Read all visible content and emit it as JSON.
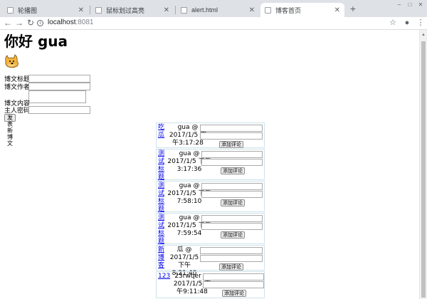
{
  "browser": {
    "tabs": [
      {
        "label": "轮播图",
        "active": false
      },
      {
        "label": "鼠标划过高亮",
        "active": false
      },
      {
        "label": "alert.html",
        "active": false
      },
      {
        "label": "博客首页",
        "active": true
      }
    ],
    "url_host": "localhost",
    "url_port": ":8081"
  },
  "page": {
    "greeting": "你好 gua",
    "form": {
      "title_label": "博文标题",
      "author_label": "博文作者",
      "content_label": "博文内容",
      "password_label": "主人密码",
      "submit_label": "发表新博文"
    },
    "comment_button": "添加评论",
    "posts": [
      {
        "title": "吃瓜",
        "author": "gua @",
        "time": "2017/1/5 下午3:17:28"
      },
      {
        "title": "测试标题",
        "author": "gua @",
        "time": "2017/1/5 下午3:17:36"
      },
      {
        "title": "测试标题",
        "author": "gua @",
        "time": "2017/1/5 下午7:58:10"
      },
      {
        "title": "测试标题",
        "author": "gua @",
        "time": "2017/1/5 下午7:59:54"
      },
      {
        "title": "新博客",
        "author": "瓜 @",
        "time": "2017/1/5 下午8:21:40"
      },
      {
        "title": "123",
        "author": "23rwqer @",
        "time": "2017/1/5 下午9:11:48"
      }
    ]
  }
}
